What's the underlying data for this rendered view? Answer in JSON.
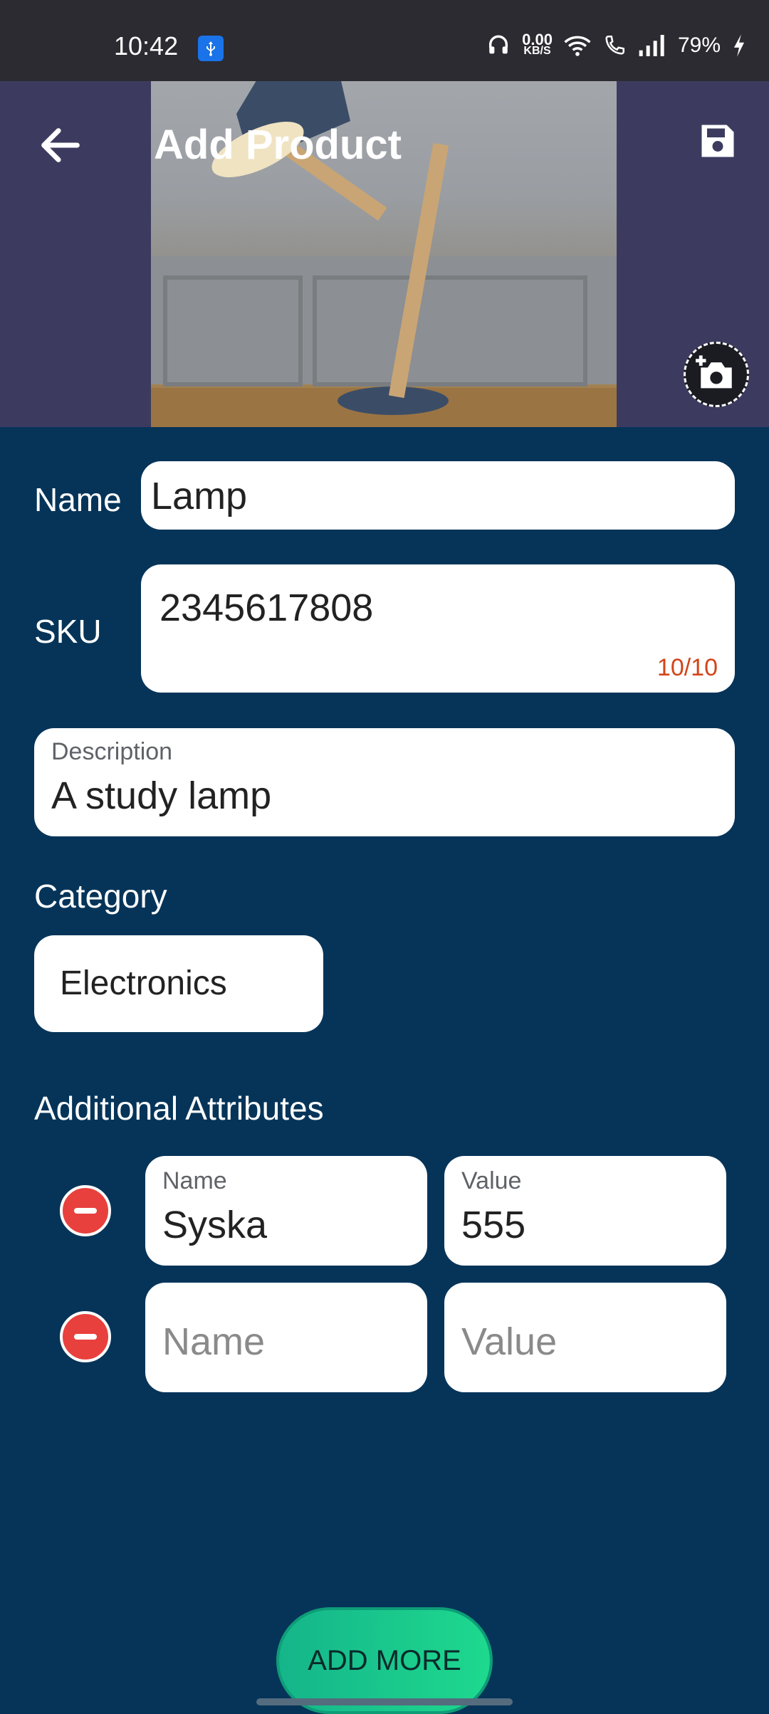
{
  "status_bar": {
    "time": "10:42",
    "net_speed_value": "0.00",
    "net_speed_unit": "KB/S",
    "battery": "79%"
  },
  "header": {
    "title": "Add Product",
    "back_icon": "arrow-left-icon",
    "save_icon": "save-icon",
    "camera_icon": "add-photo-icon"
  },
  "form": {
    "name_label": "Name",
    "name_value": "Lamp",
    "sku_label": "SKU",
    "sku_value": "2345617808",
    "sku_counter": "10/10",
    "description_label": "Description",
    "description_value": "A study lamp",
    "category_label": "Category",
    "category_value": "Electronics",
    "attributes_label": "Additional Attributes",
    "attributes": [
      {
        "name_label": "Name",
        "name_value": "Syska",
        "value_label": "Value",
        "value_value": "555"
      },
      {
        "name_placeholder": "Name",
        "value_placeholder": "Value"
      }
    ]
  },
  "actions": {
    "add_more_label": "ADD MORE"
  },
  "colors": {
    "background": "#063459",
    "header_bg": "#3c3b5f",
    "remove_red": "#e8403d",
    "add_more_green": "#1ed98e",
    "counter_orange": "#d4441a"
  }
}
